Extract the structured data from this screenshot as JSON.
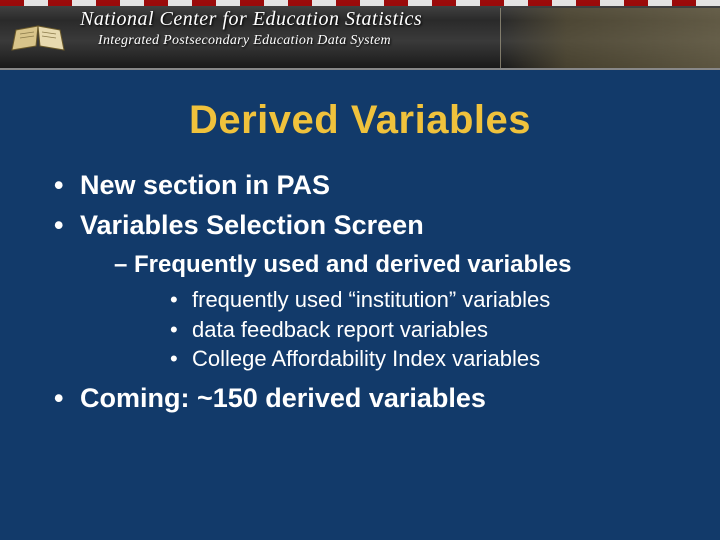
{
  "banner": {
    "title": "National Center for Education Statistics",
    "subtitle": "Integrated Postsecondary Education Data System"
  },
  "slide": {
    "title": "Derived Variables",
    "bullets": {
      "b1": "New section in PAS",
      "b2": "Variables Selection Screen",
      "b2_sub1": "Frequently used and derived variables",
      "b2_sub1_a": "frequently used “institution” variables",
      "b2_sub1_b": "data feedback report variables",
      "b2_sub1_c": "College Affordability Index variables",
      "b3": "Coming:  ~150 derived variables"
    }
  },
  "colors": {
    "background": "#123a6a",
    "title": "#f0c23c",
    "text": "#ffffff"
  }
}
